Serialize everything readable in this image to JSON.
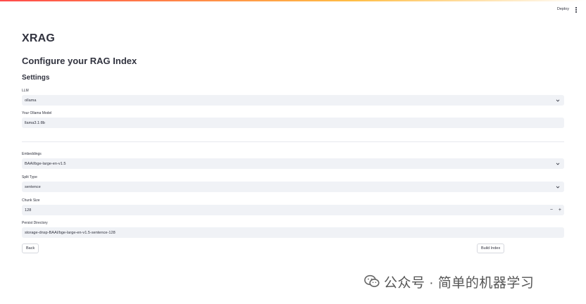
{
  "header": {
    "deploy_label": "Deploy"
  },
  "page": {
    "app_title": "XRAG",
    "section_title": "Configure your RAG Index",
    "subsection_title": "Settings"
  },
  "form": {
    "llm": {
      "label": "LLM",
      "value": "ollama"
    },
    "ollama_model": {
      "label": "Your Ollama Model",
      "value": "llama3.1:8b"
    },
    "embeddings": {
      "label": "Embeddings",
      "value": "BAAI/bge-large-en-v1.5"
    },
    "split_type": {
      "label": "Split Type",
      "value": "sentence"
    },
    "chunk_size": {
      "label": "Chunk Size",
      "value": "128",
      "decrement": "−",
      "increment": "+"
    },
    "persist_directory": {
      "label": "Persist Directory",
      "value": "storage-dnsp-BAAI/bge-large-en-v1.5-sentence-128"
    }
  },
  "buttons": {
    "back_label": "Back",
    "build_label": "Build Index"
  },
  "watermark": {
    "text": "公众号 · 简单的机器学习"
  },
  "colors": {
    "input_bg": "#f0f2f6",
    "text": "#31333f",
    "accent": "#ff4b4b"
  }
}
